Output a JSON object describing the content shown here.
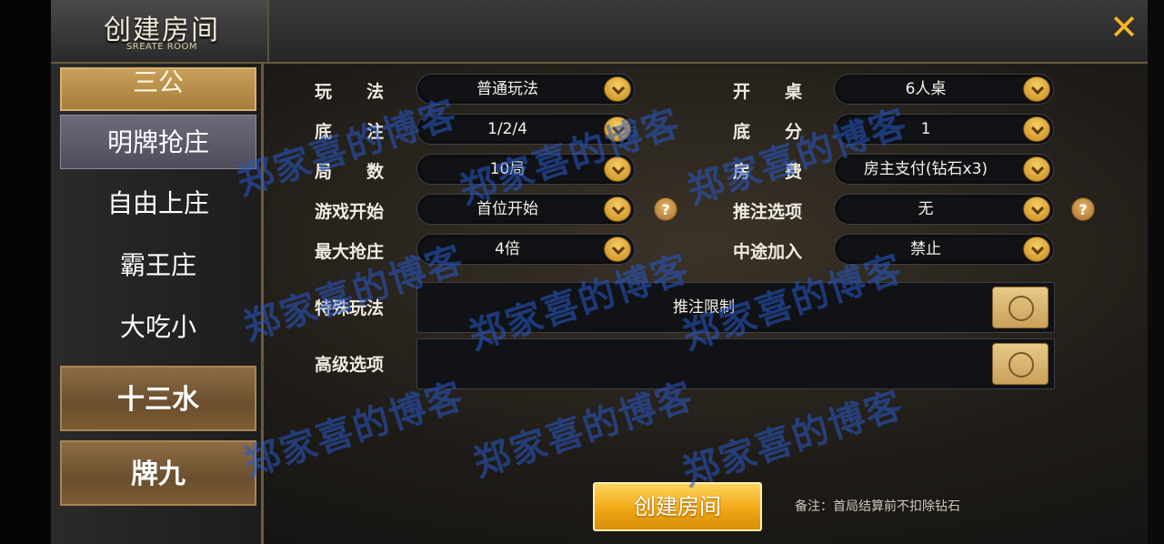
{
  "header": {
    "title": "创建房间",
    "subtitle": "SREATE ROOM"
  },
  "sidebar": {
    "items": [
      {
        "label": "三公"
      },
      {
        "label": "明牌抢庄"
      },
      {
        "label": "自由上庄"
      },
      {
        "label": "霸王庄"
      },
      {
        "label": "大吃小"
      },
      {
        "label": "十三水"
      },
      {
        "label": "牌九"
      }
    ]
  },
  "settings": {
    "left": [
      {
        "label": "玩　　法",
        "value": "普通玩法"
      },
      {
        "label": "底　　注",
        "value": "1/2/4"
      },
      {
        "label": "局　　数",
        "value": "10局"
      },
      {
        "label": "游戏开始",
        "value": "首位开始"
      },
      {
        "label": "最大抢庄",
        "value": "4倍"
      }
    ],
    "right": [
      {
        "label": "开　　桌",
        "value": "6人桌"
      },
      {
        "label": "底　　分",
        "value": "1"
      },
      {
        "label": "房　　费",
        "value": "房主支付(钻石x3)"
      },
      {
        "label": "推注选项",
        "value": "无"
      },
      {
        "label": "中途加入",
        "value": "禁止"
      }
    ],
    "special": {
      "label": "特殊玩法",
      "value": "推注限制"
    },
    "advanced": {
      "label": "高级选项",
      "value": ""
    }
  },
  "footer": {
    "create_label": "创建房间",
    "note": "备注：首局结算前不扣除钻石"
  },
  "watermark": "郑家喜的博客",
  "colors": {
    "accent": "#f0a815",
    "close": "#f5b526"
  }
}
